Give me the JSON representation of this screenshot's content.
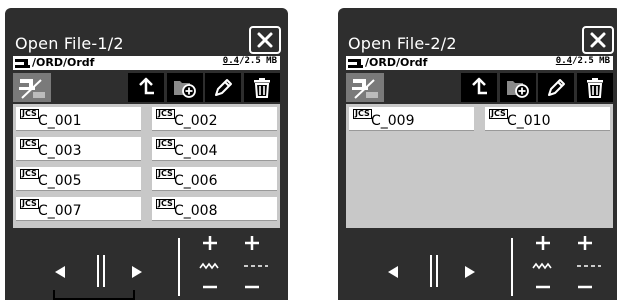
{
  "panels": [
    {
      "title": "Open File-1/2",
      "path": "/ORD/Ordf",
      "capacity_used": "0.4",
      "capacity_total": "/2.5 MB",
      "files": [
        {
          "badge": "JCS",
          "name": "C_001"
        },
        {
          "badge": "JCS",
          "name": "C_002"
        },
        {
          "badge": "JCS",
          "name": "C_003"
        },
        {
          "badge": "JCS",
          "name": "C_004"
        },
        {
          "badge": "JCS",
          "name": "C_005"
        },
        {
          "badge": "JCS",
          "name": "C_006"
        },
        {
          "badge": "JCS",
          "name": "C_007"
        },
        {
          "badge": "JCS",
          "name": "C_008"
        }
      ]
    },
    {
      "title": "Open File-2/2",
      "path": "/ORD/Ordf",
      "capacity_used": "0.4",
      "capacity_total": "/2.5 MB",
      "files": [
        {
          "badge": "JCS",
          "name": "C_009"
        },
        {
          "badge": "JCS",
          "name": "C_010"
        }
      ]
    }
  ],
  "icons": {
    "close": "close-icon",
    "machine": "sewing-machine-icon",
    "usb": "usb-device-icon",
    "up": "up-folder-arrow-icon",
    "new_folder": "new-folder-icon",
    "rename": "pencil-icon",
    "delete": "trash-icon",
    "prev": "previous-triangle-icon",
    "pause": "pause-icon",
    "next": "next-triangle-icon",
    "plus": "plus-icon",
    "minus": "minus-icon",
    "stitch": "zigzag-stitch-icon",
    "dashed": "dashed-stitch-icon"
  },
  "colors": {
    "panel_bg": "#2e2e2e",
    "file_area_bg": "#c8c8c8",
    "toolbar_button": "#000000",
    "usb_button": "#7a7a7a",
    "foreground": "#ffffff"
  }
}
